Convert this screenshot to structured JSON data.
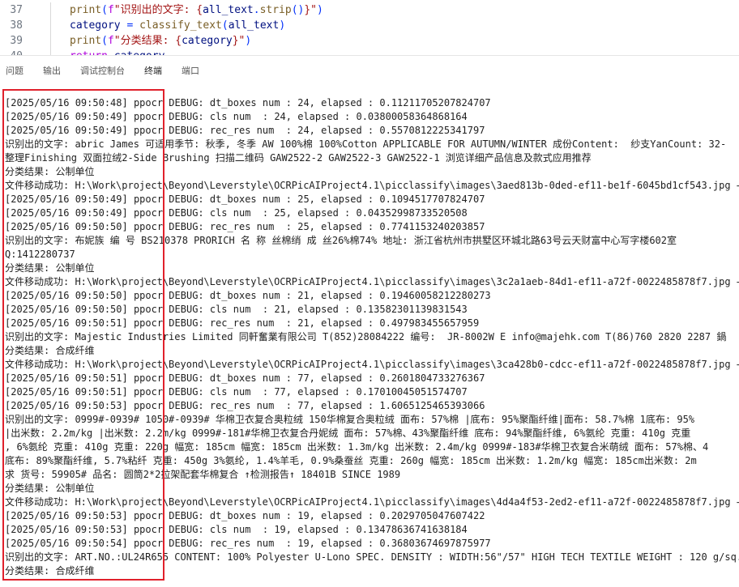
{
  "editor": {
    "lines": [
      {
        "no": "37",
        "segments": [
          [
            "fn",
            "print"
          ],
          [
            "punct",
            "("
          ],
          [
            "kw",
            "f"
          ],
          [
            "str",
            "\"识别出的文字: {"
          ],
          [
            "var",
            "all_text"
          ],
          [
            "punct",
            "."
          ],
          [
            "fn",
            "strip"
          ],
          [
            "punct",
            "()"
          ],
          [
            "str",
            "}\""
          ],
          [
            "punct",
            ")"
          ]
        ]
      },
      {
        "no": "38",
        "segments": [
          [
            "var",
            "category"
          ],
          [
            "punct",
            " = "
          ],
          [
            "fn",
            "classify_text"
          ],
          [
            "punct",
            "("
          ],
          [
            "var",
            "all_text"
          ],
          [
            "punct",
            ")"
          ]
        ]
      },
      {
        "no": "39",
        "segments": [
          [
            "fn",
            "print"
          ],
          [
            "punct",
            "("
          ],
          [
            "kw",
            "f"
          ],
          [
            "str",
            "\"分类结果: {"
          ],
          [
            "var",
            "category"
          ],
          [
            "str",
            "}\""
          ],
          [
            "punct",
            ")"
          ]
        ]
      },
      {
        "no": "40",
        "segments": [
          [
            "kw",
            "return"
          ],
          [
            "punct",
            " "
          ],
          [
            "var",
            "category"
          ]
        ]
      }
    ]
  },
  "panel": {
    "tabs": [
      {
        "label": "问题",
        "active": false
      },
      {
        "label": "输出",
        "active": false
      },
      {
        "label": "调试控制台",
        "active": false
      },
      {
        "label": "终端",
        "active": true
      },
      {
        "label": "端口",
        "active": false
      }
    ]
  },
  "terminal": {
    "lines": [
      "[2025/05/16 09:50:48] ppocr DEBUG: dt_boxes num : 24, elapsed : 0.11211705207824707",
      "[2025/05/16 09:50:49] ppocr DEBUG: cls num  : 24, elapsed : 0.03800058364868164",
      "[2025/05/16 09:50:49] ppocr DEBUG: rec_res num  : 24, elapsed : 0.5570812225341797",
      "识别出的文字: abric James 可适用季节: 秋季, 冬季 AW 100%棉 100%Cotton APPLICABLE FOR AUTUMN/WINTER 成份Content:  纱支YanCount: 32-",
      "整理Finishing 双面拉绒2-Side Brushing 扫描二维码 GAW2522-2 GAW2522-3 GAW2522-1 浏览详细产品信息及款式应用推荐",
      "分类结果: 公制单位",
      "文件移动成功: H:\\Work\\project\\Beyond\\Leverstyle\\OCRPicAIProject4.1\\picclassify\\images\\3aed813b-0ded-ef11-be1f-6045bd1cf543.jpg → H",
      "[2025/05/16 09:50:49] ppocr DEBUG: dt_boxes num : 25, elapsed : 0.1094517707824707",
      "[2025/05/16 09:50:49] ppocr DEBUG: cls num  : 25, elapsed : 0.04352998733520508",
      "[2025/05/16 09:50:50] ppocr DEBUG: rec_res num  : 25, elapsed : 0.7741153240203857",
      "识别出的文字: 布妮族 编 号 BS210378 PRORICH 名 称 丝棉绡 成 丝26%棉74% 地址: 浙江省杭州市拱墅区环城北路63号云天财富中心写字楼602室",
      "Q:1412280737",
      "分类结果: 公制单位",
      "文件移动成功: H:\\Work\\project\\Beyond\\Leverstyle\\OCRPicAIProject4.1\\picclassify\\images\\3c2a1aeb-84d1-ef11-a72f-0022485878f7.jpg → H",
      "[2025/05/16 09:50:50] ppocr DEBUG: dt_boxes num : 21, elapsed : 0.19460058212280273",
      "[2025/05/16 09:50:50] ppocr DEBUG: cls num  : 21, elapsed : 0.13582301139831543",
      "[2025/05/16 09:50:51] ppocr DEBUG: rec_res num  : 21, elapsed : 0.497983455657959",
      "识别出的文字: Majestic Industries Limited 同軒奮業有限公司 T(852)28084222 编号:  JR-8002W E info@majehk.com T(86)760 2820 2287 鍋",
      "分类结果: 合成纤维",
      "文件移动成功: H:\\Work\\project\\Beyond\\Leverstyle\\OCRPicAIProject4.1\\picclassify\\images\\3ca428b0-cdcc-ef11-a72f-0022485878f7.jpg → H",
      "[2025/05/16 09:50:51] ppocr DEBUG: dt_boxes num : 77, elapsed : 0.2601804733276367",
      "[2025/05/16 09:50:51] ppocr DEBUG: cls num  : 77, elapsed : 0.17010045051574707",
      "[2025/05/16 09:50:53] ppocr DEBUG: rec_res num  : 77, elapsed : 1.6065125465393066",
      "识别出的文字: 0999#-0939# 1050#-0939# 华棉卫衣复合奥粒绒 150华棉复合奥粒绒 面布: 57%棉 |底布: 95%聚酯纤维|面布: 58.7%棉 1底布: 95%",
      "|出米数: 2.2m/kg |出米数: 2.2m/kg 0999#-181#华棉卫衣复合丹妮绒 面布: 57%棉、43%聚酯纤维 底布: 94%聚酯纤维, 6%氨纶 克重: 410g 克重",
      ", 6%氨纶 克重: 410g 克重: 220g 幅宽: 185cm 幅宽: 185cm 出米数: 1.3m/kg 出米数: 2.4m/kg 0999#-183#华棉卫衣复合米萌绒 面布: 57%棉、4",
      "底布: 89%聚酯纤维, 5.7%粘纤 克重: 450g 3%氨纶, 1.4%羊毛, 0.9%桑蚕丝 克重: 260g 幅宽: 185cm 出米数: 1.2m/kg 幅宽: 185cm出米数: 2m",
      "求 货号: 59905# 品名: 圆筒2*2拉架配套华棉复合 ↑检测报告↑ 18401B SINCE 1989",
      "分类结果: 公制单位",
      "文件移动成功: H:\\Work\\project\\Beyond\\Leverstyle\\OCRPicAIProject4.1\\picclassify\\images\\4d4a4f53-2ed2-ef11-a72f-0022485878f7.jpg → H",
      "[2025/05/16 09:50:53] ppocr DEBUG: dt_boxes num : 19, elapsed : 0.2029705047607422",
      "[2025/05/16 09:50:53] ppocr DEBUG: cls num  : 19, elapsed : 0.13478636741638184",
      "[2025/05/16 09:50:54] ppocr DEBUG: rec_res num  : 19, elapsed : 0.36803674697875977",
      "识别出的文字: ART.NO.:UL24R655 CONTENT: 100% Polyester U-Lono SPEC. DENSITY : WIDTH:56\"/57\" HIGH TECH TEXTILE WEIGHT : 120 g/sq.m",
      "分类结果: 合成纤维"
    ]
  }
}
